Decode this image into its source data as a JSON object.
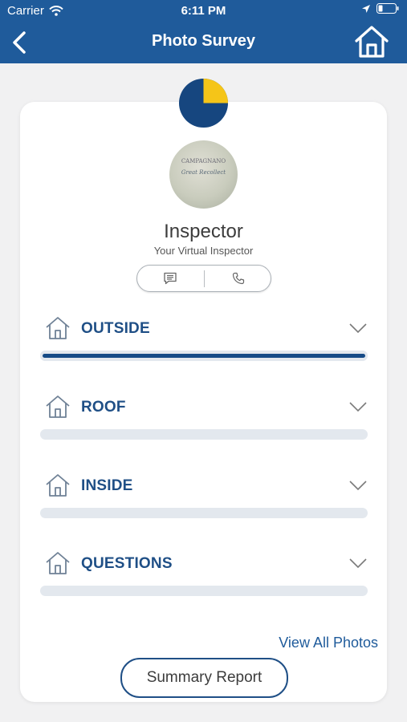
{
  "status_bar": {
    "carrier": "Carrier",
    "time": "6:11 PM"
  },
  "nav": {
    "title": "Photo Survey"
  },
  "progress_chart": {
    "completed_fraction": 0.25,
    "colors": {
      "completed": "#f5c518",
      "remaining": "#16467f"
    }
  },
  "inspector": {
    "name": "Inspector",
    "subtitle": "Your Virtual Inspector",
    "avatar_text_top": "CAMPAGNANO",
    "avatar_text_bottom": "Great Recollect"
  },
  "sections": [
    {
      "label": "OUTSIDE",
      "progress": 1.0,
      "active": true
    },
    {
      "label": "ROOF",
      "progress": 0,
      "active": false
    },
    {
      "label": "INSIDE",
      "progress": 0,
      "active": false
    },
    {
      "label": "QUESTIONS",
      "progress": 0,
      "active": false
    }
  ],
  "links": {
    "view_all_photos": "View All Photos",
    "summary_report": "Summary Report"
  },
  "colors": {
    "nav_bg": "#1f5b9b",
    "accent": "#1f4f86",
    "track": "#e3e8ee"
  }
}
